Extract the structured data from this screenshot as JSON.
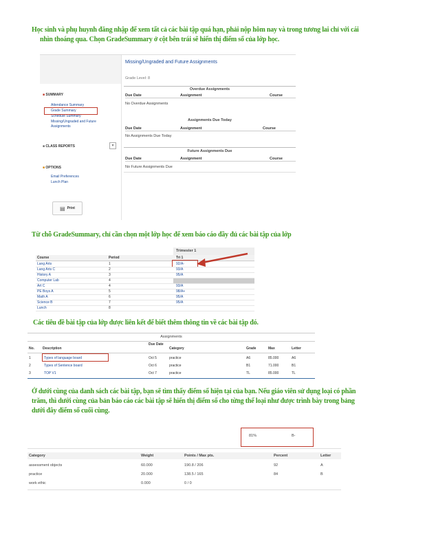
{
  "paragraphs": {
    "p1_line1": "Học sinh và phụ huynh đăng nhập để xem tất cả các bài tập quá hạn, phải nộp hôm nay và trong tương lai chỉ với cái",
    "p1_line2": "nhìn thoáng qua. Chọn GradeSummary ở cột bên trái sẽ hiển thị điểm số của lớp học.",
    "p2": "Từ chỗ GradeSummary, chỉ cần chọn một lớp học để xem báo cáo đầy đủ các bài tập của lớp",
    "p3": "Các tiêu đề bài tập của lớp được liên kết để biết thêm thông tin về các bài tập đó.",
    "p4_line1": "Ở dưới cùng của danh sách các bài tập, bạn sẽ tìm thấy điểm số hiện tại của bạn. Nếu giáo viên sử dụng loại có phần",
    "p4_line2": "trăm, thì dưới cùng của bản báo cáo các bài tập sẽ hiển thị điểm số cho từng thể loại như được trình bày trong bảng",
    "p4_line3": "dưới đây điểm số cuối cùng."
  },
  "shot1": {
    "page_title": "Missing/Ungraded and Future Assignments",
    "sub": "Grade Level: 8",
    "sidebar": {
      "summary": "SUMMARY",
      "items": [
        "Attendance Summary",
        "Grade Summary",
        "Schedule Summary",
        "Missing/Ungraded and Future",
        "Assignments"
      ],
      "class_reports": "CLASS REPORTS",
      "options": "OPTIONS",
      "option_items": [
        "Email Preferences",
        "Lunch Plan"
      ],
      "print": "Print"
    },
    "sections": [
      {
        "title": "Overdue Assignments",
        "cols": [
          "Due Date",
          "Assignment",
          "Course"
        ],
        "empty": "No Overdue Assignments"
      },
      {
        "title": "Assignments Due Today",
        "cols": [
          "Due Date",
          "Assignment",
          "Course"
        ],
        "empty": "No Assignments Due Today"
      },
      {
        "title": "Future Assignments Due",
        "cols": [
          "Due Date",
          "Assignment",
          "Course"
        ],
        "empty": "No Future Assignments Due"
      }
    ]
  },
  "shot2": {
    "trimester": "Trimester 1",
    "col_course": "Course",
    "col_period": "Period",
    "col_tri": "Tri 1",
    "rows": [
      {
        "course": "Lang Arts",
        "period": "1",
        "grade": "92/A-"
      },
      {
        "course": "Lang Arts C",
        "period": "2",
        "grade": "93/A"
      },
      {
        "course": "History A",
        "period": "3",
        "grade": "95/A"
      },
      {
        "course": "Computer Lab",
        "period": "4",
        "grade": ""
      },
      {
        "course": "Art C",
        "period": "4",
        "grade": "93/A"
      },
      {
        "course": "PE Boys A",
        "period": "5",
        "grade": "98/A+"
      },
      {
        "course": "Math A",
        "period": "6",
        "grade": "95/A"
      },
      {
        "course": "Science B",
        "period": "7",
        "grade": "95/A"
      },
      {
        "course": "Lunch",
        "period": "8",
        "grade": ""
      }
    ]
  },
  "shot3": {
    "title": "Assignments",
    "cols": [
      "No.",
      "Description",
      "Due Date",
      "Category",
      "Grade",
      "Max",
      "Letter"
    ],
    "rows": [
      {
        "no": "1",
        "desc": "Types of language board",
        "date": "Oct 5",
        "cat": "practice",
        "grade": "A6",
        "max": "85.000",
        "letter": "A6"
      },
      {
        "no": "2",
        "desc": "Types of Sentence board",
        "date": "Oct 6",
        "cat": "practice",
        "grade": "B1",
        "max": "71.000",
        "letter": "B1"
      },
      {
        "no": "3",
        "desc": "TOP V1",
        "date": "Oct 7",
        "cat": "practice",
        "grade": "TL",
        "max": "85.000",
        "letter": "TL"
      }
    ]
  },
  "shot4": {
    "total_pct": "81%",
    "total_letter": "B-",
    "cols": [
      "Category",
      "Weight",
      "Points / Max pts.",
      "Percent",
      "Letter"
    ],
    "rows": [
      {
        "cat": "assessment objects",
        "weight": "60.000",
        "points": "190.8 / 206",
        "pct": "92",
        "letter": "A"
      },
      {
        "cat": "practice",
        "weight": "20.000",
        "points": "138.5 / 165",
        "pct": "84",
        "letter": "B"
      },
      {
        "cat": "work ethic",
        "weight": "0.000",
        "points": "0 / 0",
        "pct": "",
        "letter": ""
      }
    ]
  },
  "colors": {
    "green_text": "#3c9a1f",
    "red_highlight": "#c0392b",
    "link_blue": "#1a4a9a"
  }
}
